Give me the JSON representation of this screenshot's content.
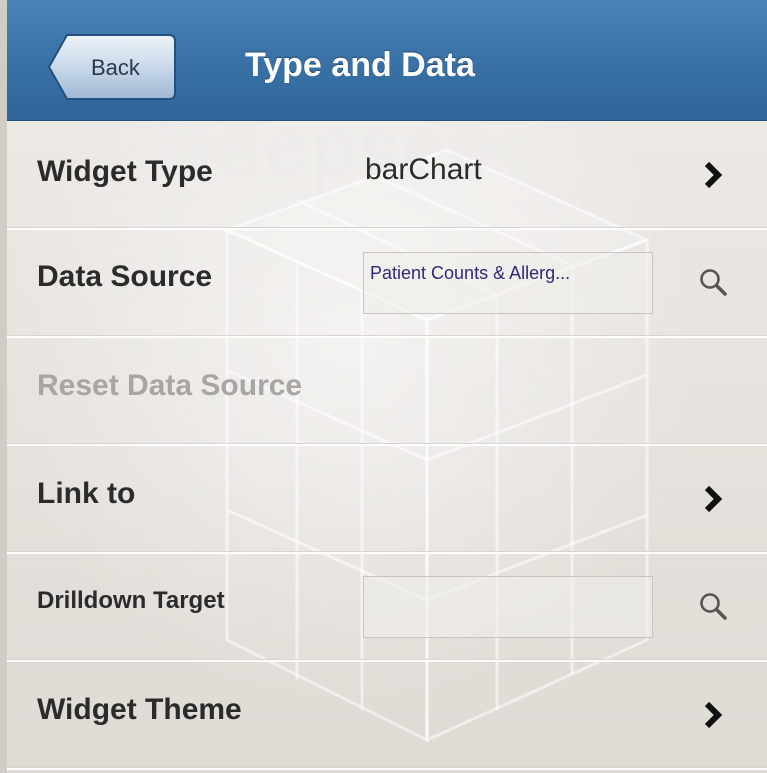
{
  "header": {
    "back_label": "Back",
    "title": "Type and Data"
  },
  "watermark": "Deepsee",
  "rows": {
    "widget_type": {
      "label": "Widget Type",
      "value": "barChart"
    },
    "data_source": {
      "label": "Data Source",
      "value": "Patient Counts & Allerg..."
    },
    "reset_data_source": {
      "label": "Reset Data Source"
    },
    "link_to": {
      "label": "Link to"
    },
    "drilldown_target": {
      "label": "Drilldown Target",
      "value": ""
    },
    "widget_theme": {
      "label": "Widget Theme"
    }
  },
  "icons": {
    "chevron": "chevron-right-icon",
    "search": "search-icon"
  },
  "colors": {
    "header": "#3b73a8",
    "disabled_text": "#a8a6a2",
    "field_text": "#2c2a7a"
  }
}
